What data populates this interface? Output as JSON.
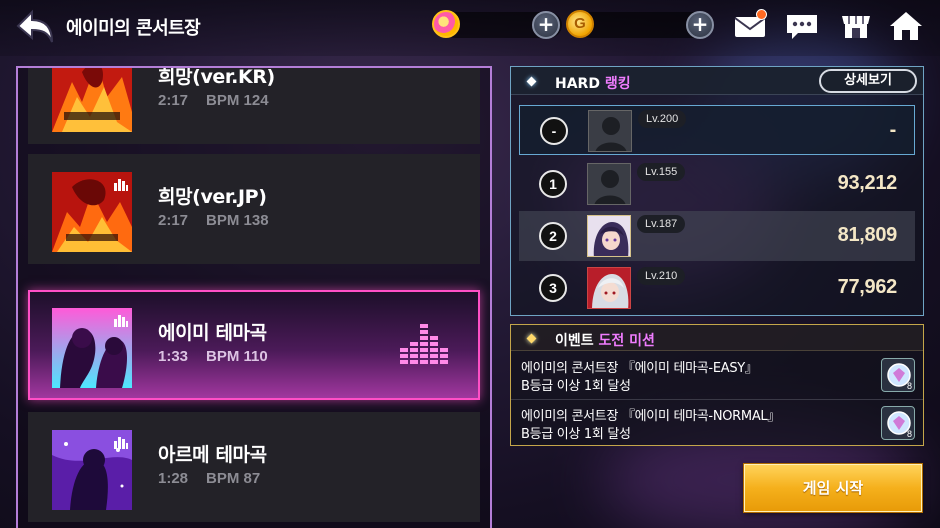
{
  "header": {
    "title": "에이미의 콘서트장",
    "icons": {
      "back": "back-arrow-icon",
      "gem": "gem-currency-icon",
      "gold": "gold-coin-icon",
      "mail": "mail-icon",
      "chat": "chat-icon",
      "shop": "shop-icon",
      "home": "home-icon"
    },
    "gold_symbol": "G",
    "plus": "+"
  },
  "songs": [
    {
      "name": "희망(ver.KR)",
      "time": "2:17",
      "bpm": "BPM 124"
    },
    {
      "name": "희망(ver.JP)",
      "time": "2:17",
      "bpm": "BPM 138"
    },
    {
      "name": "에이미 테마곡",
      "time": "1:33",
      "bpm": "BPM 110",
      "selected": true
    },
    {
      "name": "아르메 테마곡",
      "time": "1:28",
      "bpm": "BPM 87"
    }
  ],
  "ranking": {
    "difficulty": "HARD",
    "title_suffix": "랭킹",
    "detail_button": "상세보기",
    "rows": [
      {
        "rank": "-",
        "level": "Lv.200",
        "score": "-"
      },
      {
        "rank": "1",
        "level": "Lv.155",
        "score": "93,212"
      },
      {
        "rank": "2",
        "level": "Lv.187",
        "score": "81,809"
      },
      {
        "rank": "3",
        "level": "Lv.210",
        "score": "77,962"
      }
    ]
  },
  "mission": {
    "title_prefix": "이벤트",
    "title_accent": "도전 미션",
    "items": [
      {
        "line1": "에이미의 콘서트장 『에이미 테마곡-EASY』",
        "line2": "B등급 이상 1회 달성",
        "reward_count": "8"
      },
      {
        "line1": "에이미의 콘서트장 『에이미 테마곡-NORMAL』",
        "line2": "B등급 이상 1회 달성",
        "reward_count": "8"
      }
    ]
  },
  "start_button": "게임 시작",
  "colors": {
    "accent_pink": "#ff4fc6",
    "ranking_border": "#6fa4c4",
    "mission_border": "#c4a64a",
    "start_button": "#f5b01c",
    "score_text": "#f4e7c6"
  }
}
